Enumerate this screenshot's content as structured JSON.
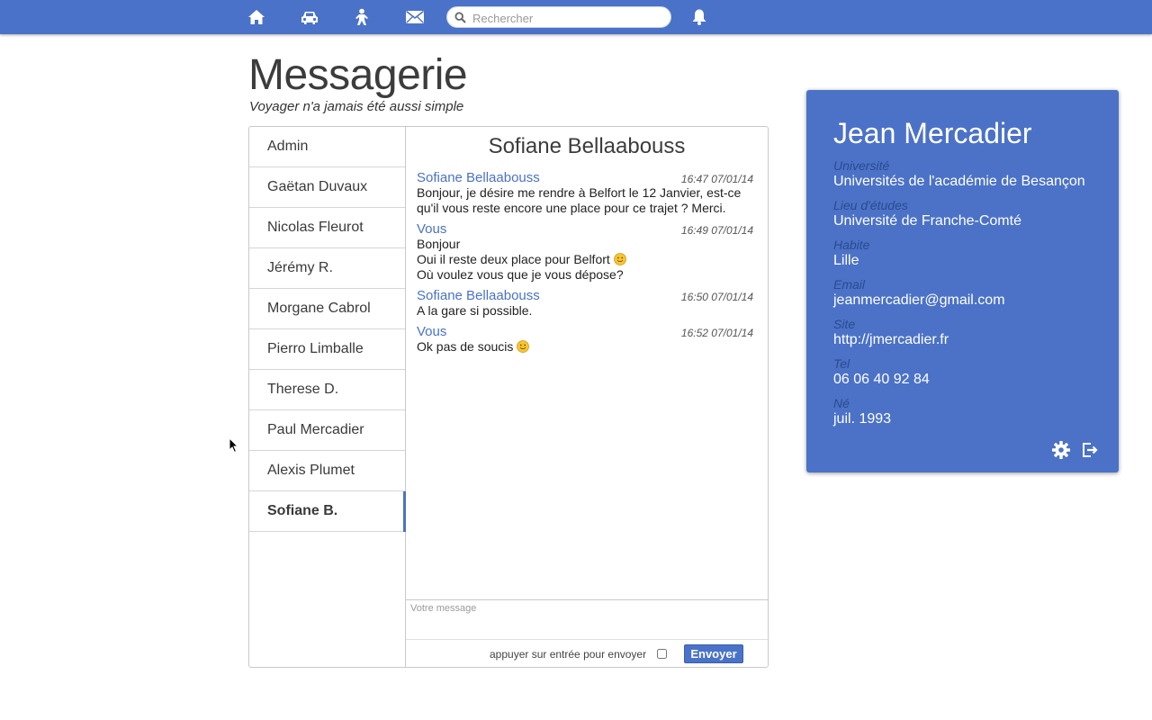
{
  "nav": {
    "icons": [
      "home-icon",
      "car-icon",
      "person-icon",
      "mail-icon",
      "bell-icon"
    ],
    "search_placeholder": "Rechercher"
  },
  "header": {
    "title": "Messagerie",
    "subtitle": "Voyager n'a jamais été aussi simple"
  },
  "contacts": [
    {
      "name": "Admin",
      "active": false
    },
    {
      "name": "Gaëtan Duvaux",
      "active": false
    },
    {
      "name": "Nicolas Fleurot",
      "active": false
    },
    {
      "name": "Jérémy R.",
      "active": false
    },
    {
      "name": "Morgane Cabrol",
      "active": false
    },
    {
      "name": "Pierro Limballe",
      "active": false
    },
    {
      "name": "Therese D.",
      "active": false
    },
    {
      "name": "Paul Mercadier",
      "active": false
    },
    {
      "name": "Alexis Plumet",
      "active": false
    },
    {
      "name": "Sofiane B.",
      "active": true
    }
  ],
  "chat": {
    "title": "Sofiane Bellaabouss",
    "messages": [
      {
        "author": "Sofiane Bellaabouss",
        "time": "16:47 07/01/14",
        "lines": [
          "Bonjour, je désire me rendre à Belfort le 12 Janvier, est-ce qu'il vous reste encore une place pour ce trajet ? Merci."
        ]
      },
      {
        "author": "Vous",
        "time": "16:49 07/01/14",
        "lines": [
          "Bonjour",
          "Oui il reste deux place pour Belfort",
          "Où voulez vous que je vous dépose?"
        ]
      },
      {
        "author": "Sofiane Bellaabouss",
        "time": "16:50 07/01/14",
        "lines": [
          "A la gare si possible."
        ]
      },
      {
        "author": "Vous",
        "time": "16:52 07/01/14",
        "lines": [
          "Ok pas de soucis"
        ]
      }
    ],
    "compose_placeholder": "Votre message",
    "enter_hint": "appuyer sur entrée pour envoyer",
    "send_label": "Envoyer"
  },
  "profile": {
    "name": "Jean Mercadier",
    "fields": {
      "universite": {
        "label": "Université",
        "value": "Universités de l'académie de Besançon"
      },
      "lieu": {
        "label": "Lieu d'études",
        "value": "Université de Franche-Comté"
      },
      "habite": {
        "label": "Habite",
        "value": "Lille"
      },
      "email": {
        "label": "Email",
        "value": "jeanmercadier@gmail.com"
      },
      "site": {
        "label": "Site",
        "value": "http://jmercadier.fr"
      },
      "tel": {
        "label": "Tel",
        "value": "06 06 40 92 84"
      },
      "ne": {
        "label": "Né",
        "value": "juil. 1993"
      }
    },
    "actions": [
      "gear-icon",
      "logout-icon"
    ]
  },
  "colors": {
    "accent": "#4a72c8",
    "profile_bg": "#4b72c7",
    "label_dark_blue": "#2b4b8f"
  }
}
